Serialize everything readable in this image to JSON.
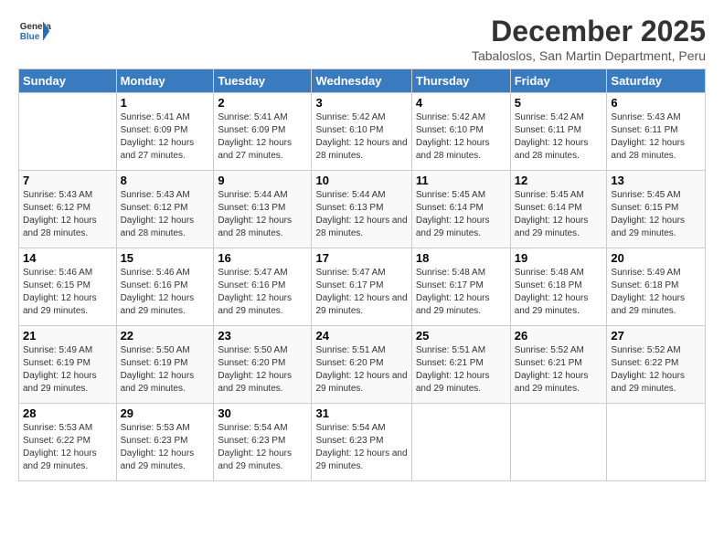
{
  "logo": {
    "general": "General",
    "blue": "Blue"
  },
  "title": "December 2025",
  "subtitle": "Tabaloslos, San Martin Department, Peru",
  "headers": [
    "Sunday",
    "Monday",
    "Tuesday",
    "Wednesday",
    "Thursday",
    "Friday",
    "Saturday"
  ],
  "weeks": [
    [
      {
        "num": "",
        "sunrise": "",
        "sunset": "",
        "daylight": ""
      },
      {
        "num": "1",
        "sunrise": "Sunrise: 5:41 AM",
        "sunset": "Sunset: 6:09 PM",
        "daylight": "Daylight: 12 hours and 27 minutes."
      },
      {
        "num": "2",
        "sunrise": "Sunrise: 5:41 AM",
        "sunset": "Sunset: 6:09 PM",
        "daylight": "Daylight: 12 hours and 27 minutes."
      },
      {
        "num": "3",
        "sunrise": "Sunrise: 5:42 AM",
        "sunset": "Sunset: 6:10 PM",
        "daylight": "Daylight: 12 hours and 28 minutes."
      },
      {
        "num": "4",
        "sunrise": "Sunrise: 5:42 AM",
        "sunset": "Sunset: 6:10 PM",
        "daylight": "Daylight: 12 hours and 28 minutes."
      },
      {
        "num": "5",
        "sunrise": "Sunrise: 5:42 AM",
        "sunset": "Sunset: 6:11 PM",
        "daylight": "Daylight: 12 hours and 28 minutes."
      },
      {
        "num": "6",
        "sunrise": "Sunrise: 5:43 AM",
        "sunset": "Sunset: 6:11 PM",
        "daylight": "Daylight: 12 hours and 28 minutes."
      }
    ],
    [
      {
        "num": "7",
        "sunrise": "Sunrise: 5:43 AM",
        "sunset": "Sunset: 6:12 PM",
        "daylight": "Daylight: 12 hours and 28 minutes."
      },
      {
        "num": "8",
        "sunrise": "Sunrise: 5:43 AM",
        "sunset": "Sunset: 6:12 PM",
        "daylight": "Daylight: 12 hours and 28 minutes."
      },
      {
        "num": "9",
        "sunrise": "Sunrise: 5:44 AM",
        "sunset": "Sunset: 6:13 PM",
        "daylight": "Daylight: 12 hours and 28 minutes."
      },
      {
        "num": "10",
        "sunrise": "Sunrise: 5:44 AM",
        "sunset": "Sunset: 6:13 PM",
        "daylight": "Daylight: 12 hours and 28 minutes."
      },
      {
        "num": "11",
        "sunrise": "Sunrise: 5:45 AM",
        "sunset": "Sunset: 6:14 PM",
        "daylight": "Daylight: 12 hours and 29 minutes."
      },
      {
        "num": "12",
        "sunrise": "Sunrise: 5:45 AM",
        "sunset": "Sunset: 6:14 PM",
        "daylight": "Daylight: 12 hours and 29 minutes."
      },
      {
        "num": "13",
        "sunrise": "Sunrise: 5:45 AM",
        "sunset": "Sunset: 6:15 PM",
        "daylight": "Daylight: 12 hours and 29 minutes."
      }
    ],
    [
      {
        "num": "14",
        "sunrise": "Sunrise: 5:46 AM",
        "sunset": "Sunset: 6:15 PM",
        "daylight": "Daylight: 12 hours and 29 minutes."
      },
      {
        "num": "15",
        "sunrise": "Sunrise: 5:46 AM",
        "sunset": "Sunset: 6:16 PM",
        "daylight": "Daylight: 12 hours and 29 minutes."
      },
      {
        "num": "16",
        "sunrise": "Sunrise: 5:47 AM",
        "sunset": "Sunset: 6:16 PM",
        "daylight": "Daylight: 12 hours and 29 minutes."
      },
      {
        "num": "17",
        "sunrise": "Sunrise: 5:47 AM",
        "sunset": "Sunset: 6:17 PM",
        "daylight": "Daylight: 12 hours and 29 minutes."
      },
      {
        "num": "18",
        "sunrise": "Sunrise: 5:48 AM",
        "sunset": "Sunset: 6:17 PM",
        "daylight": "Daylight: 12 hours and 29 minutes."
      },
      {
        "num": "19",
        "sunrise": "Sunrise: 5:48 AM",
        "sunset": "Sunset: 6:18 PM",
        "daylight": "Daylight: 12 hours and 29 minutes."
      },
      {
        "num": "20",
        "sunrise": "Sunrise: 5:49 AM",
        "sunset": "Sunset: 6:18 PM",
        "daylight": "Daylight: 12 hours and 29 minutes."
      }
    ],
    [
      {
        "num": "21",
        "sunrise": "Sunrise: 5:49 AM",
        "sunset": "Sunset: 6:19 PM",
        "daylight": "Daylight: 12 hours and 29 minutes."
      },
      {
        "num": "22",
        "sunrise": "Sunrise: 5:50 AM",
        "sunset": "Sunset: 6:19 PM",
        "daylight": "Daylight: 12 hours and 29 minutes."
      },
      {
        "num": "23",
        "sunrise": "Sunrise: 5:50 AM",
        "sunset": "Sunset: 6:20 PM",
        "daylight": "Daylight: 12 hours and 29 minutes."
      },
      {
        "num": "24",
        "sunrise": "Sunrise: 5:51 AM",
        "sunset": "Sunset: 6:20 PM",
        "daylight": "Daylight: 12 hours and 29 minutes."
      },
      {
        "num": "25",
        "sunrise": "Sunrise: 5:51 AM",
        "sunset": "Sunset: 6:21 PM",
        "daylight": "Daylight: 12 hours and 29 minutes."
      },
      {
        "num": "26",
        "sunrise": "Sunrise: 5:52 AM",
        "sunset": "Sunset: 6:21 PM",
        "daylight": "Daylight: 12 hours and 29 minutes."
      },
      {
        "num": "27",
        "sunrise": "Sunrise: 5:52 AM",
        "sunset": "Sunset: 6:22 PM",
        "daylight": "Daylight: 12 hours and 29 minutes."
      }
    ],
    [
      {
        "num": "28",
        "sunrise": "Sunrise: 5:53 AM",
        "sunset": "Sunset: 6:22 PM",
        "daylight": "Daylight: 12 hours and 29 minutes."
      },
      {
        "num": "29",
        "sunrise": "Sunrise: 5:53 AM",
        "sunset": "Sunset: 6:23 PM",
        "daylight": "Daylight: 12 hours and 29 minutes."
      },
      {
        "num": "30",
        "sunrise": "Sunrise: 5:54 AM",
        "sunset": "Sunset: 6:23 PM",
        "daylight": "Daylight: 12 hours and 29 minutes."
      },
      {
        "num": "31",
        "sunrise": "Sunrise: 5:54 AM",
        "sunset": "Sunset: 6:23 PM",
        "daylight": "Daylight: 12 hours and 29 minutes."
      },
      {
        "num": "",
        "sunrise": "",
        "sunset": "",
        "daylight": ""
      },
      {
        "num": "",
        "sunrise": "",
        "sunset": "",
        "daylight": ""
      },
      {
        "num": "",
        "sunrise": "",
        "sunset": "",
        "daylight": ""
      }
    ]
  ]
}
